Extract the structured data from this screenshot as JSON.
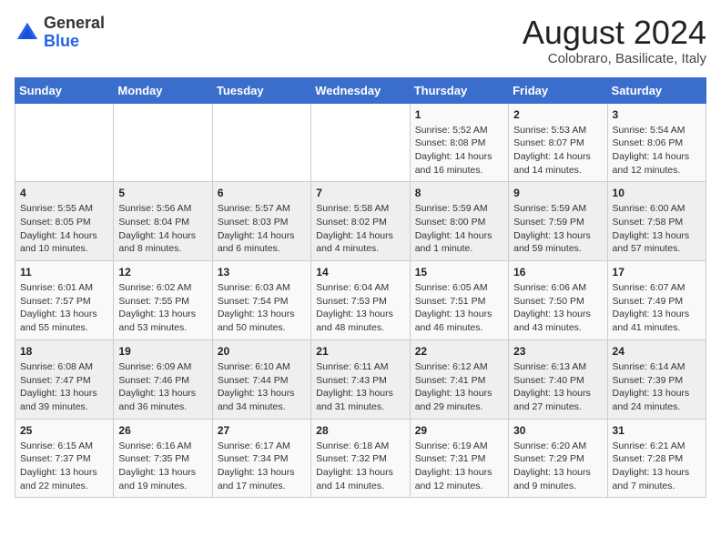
{
  "header": {
    "logo_general": "General",
    "logo_blue": "Blue",
    "month_title": "August 2024",
    "location": "Colobraro, Basilicate, Italy"
  },
  "days_of_week": [
    "Sunday",
    "Monday",
    "Tuesday",
    "Wednesday",
    "Thursday",
    "Friday",
    "Saturday"
  ],
  "weeks": [
    [
      {
        "day": "",
        "info": ""
      },
      {
        "day": "",
        "info": ""
      },
      {
        "day": "",
        "info": ""
      },
      {
        "day": "",
        "info": ""
      },
      {
        "day": "1",
        "info": "Sunrise: 5:52 AM\nSunset: 8:08 PM\nDaylight: 14 hours and 16 minutes."
      },
      {
        "day": "2",
        "info": "Sunrise: 5:53 AM\nSunset: 8:07 PM\nDaylight: 14 hours and 14 minutes."
      },
      {
        "day": "3",
        "info": "Sunrise: 5:54 AM\nSunset: 8:06 PM\nDaylight: 14 hours and 12 minutes."
      }
    ],
    [
      {
        "day": "4",
        "info": "Sunrise: 5:55 AM\nSunset: 8:05 PM\nDaylight: 14 hours and 10 minutes."
      },
      {
        "day": "5",
        "info": "Sunrise: 5:56 AM\nSunset: 8:04 PM\nDaylight: 14 hours and 8 minutes."
      },
      {
        "day": "6",
        "info": "Sunrise: 5:57 AM\nSunset: 8:03 PM\nDaylight: 14 hours and 6 minutes."
      },
      {
        "day": "7",
        "info": "Sunrise: 5:58 AM\nSunset: 8:02 PM\nDaylight: 14 hours and 4 minutes."
      },
      {
        "day": "8",
        "info": "Sunrise: 5:59 AM\nSunset: 8:00 PM\nDaylight: 14 hours and 1 minute."
      },
      {
        "day": "9",
        "info": "Sunrise: 5:59 AM\nSunset: 7:59 PM\nDaylight: 13 hours and 59 minutes."
      },
      {
        "day": "10",
        "info": "Sunrise: 6:00 AM\nSunset: 7:58 PM\nDaylight: 13 hours and 57 minutes."
      }
    ],
    [
      {
        "day": "11",
        "info": "Sunrise: 6:01 AM\nSunset: 7:57 PM\nDaylight: 13 hours and 55 minutes."
      },
      {
        "day": "12",
        "info": "Sunrise: 6:02 AM\nSunset: 7:55 PM\nDaylight: 13 hours and 53 minutes."
      },
      {
        "day": "13",
        "info": "Sunrise: 6:03 AM\nSunset: 7:54 PM\nDaylight: 13 hours and 50 minutes."
      },
      {
        "day": "14",
        "info": "Sunrise: 6:04 AM\nSunset: 7:53 PM\nDaylight: 13 hours and 48 minutes."
      },
      {
        "day": "15",
        "info": "Sunrise: 6:05 AM\nSunset: 7:51 PM\nDaylight: 13 hours and 46 minutes."
      },
      {
        "day": "16",
        "info": "Sunrise: 6:06 AM\nSunset: 7:50 PM\nDaylight: 13 hours and 43 minutes."
      },
      {
        "day": "17",
        "info": "Sunrise: 6:07 AM\nSunset: 7:49 PM\nDaylight: 13 hours and 41 minutes."
      }
    ],
    [
      {
        "day": "18",
        "info": "Sunrise: 6:08 AM\nSunset: 7:47 PM\nDaylight: 13 hours and 39 minutes."
      },
      {
        "day": "19",
        "info": "Sunrise: 6:09 AM\nSunset: 7:46 PM\nDaylight: 13 hours and 36 minutes."
      },
      {
        "day": "20",
        "info": "Sunrise: 6:10 AM\nSunset: 7:44 PM\nDaylight: 13 hours and 34 minutes."
      },
      {
        "day": "21",
        "info": "Sunrise: 6:11 AM\nSunset: 7:43 PM\nDaylight: 13 hours and 31 minutes."
      },
      {
        "day": "22",
        "info": "Sunrise: 6:12 AM\nSunset: 7:41 PM\nDaylight: 13 hours and 29 minutes."
      },
      {
        "day": "23",
        "info": "Sunrise: 6:13 AM\nSunset: 7:40 PM\nDaylight: 13 hours and 27 minutes."
      },
      {
        "day": "24",
        "info": "Sunrise: 6:14 AM\nSunset: 7:39 PM\nDaylight: 13 hours and 24 minutes."
      }
    ],
    [
      {
        "day": "25",
        "info": "Sunrise: 6:15 AM\nSunset: 7:37 PM\nDaylight: 13 hours and 22 minutes."
      },
      {
        "day": "26",
        "info": "Sunrise: 6:16 AM\nSunset: 7:35 PM\nDaylight: 13 hours and 19 minutes."
      },
      {
        "day": "27",
        "info": "Sunrise: 6:17 AM\nSunset: 7:34 PM\nDaylight: 13 hours and 17 minutes."
      },
      {
        "day": "28",
        "info": "Sunrise: 6:18 AM\nSunset: 7:32 PM\nDaylight: 13 hours and 14 minutes."
      },
      {
        "day": "29",
        "info": "Sunrise: 6:19 AM\nSunset: 7:31 PM\nDaylight: 13 hours and 12 minutes."
      },
      {
        "day": "30",
        "info": "Sunrise: 6:20 AM\nSunset: 7:29 PM\nDaylight: 13 hours and 9 minutes."
      },
      {
        "day": "31",
        "info": "Sunrise: 6:21 AM\nSunset: 7:28 PM\nDaylight: 13 hours and 7 minutes."
      }
    ]
  ]
}
